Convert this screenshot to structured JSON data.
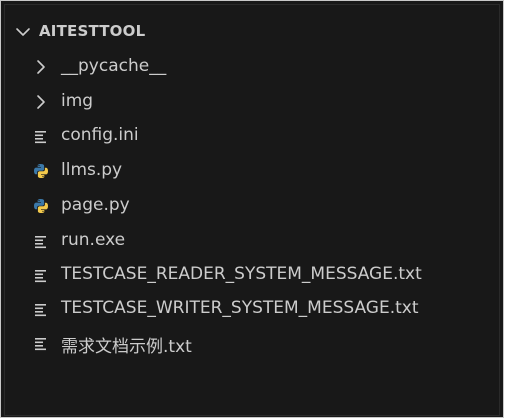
{
  "explorer": {
    "root_label": "AITESTTOOL",
    "items": [
      {
        "label": "__pycache__",
        "kind": "folder",
        "icon": "chevron-right-icon"
      },
      {
        "label": "img",
        "kind": "folder",
        "icon": "chevron-right-icon"
      },
      {
        "label": "config.ini",
        "kind": "file",
        "icon": "text-lines-icon"
      },
      {
        "label": "llms.py",
        "kind": "file",
        "icon": "python-icon"
      },
      {
        "label": "page.py",
        "kind": "file",
        "icon": "python-icon"
      },
      {
        "label": "run.exe",
        "kind": "file",
        "icon": "text-lines-icon"
      },
      {
        "label": "TESTCASE_READER_SYSTEM_MESSAGE.txt",
        "kind": "file",
        "icon": "text-lines-icon"
      },
      {
        "label": "TESTCASE_WRITER_SYSTEM_MESSAGE.txt",
        "kind": "file",
        "icon": "text-lines-icon"
      },
      {
        "label": "需求文档示例.txt",
        "kind": "file",
        "icon": "text-lines-icon"
      }
    ]
  },
  "colors": {
    "background": "#181818",
    "text": "#cccccc",
    "python_blue": "#3b78a8",
    "python_yellow": "#f2c94c"
  }
}
